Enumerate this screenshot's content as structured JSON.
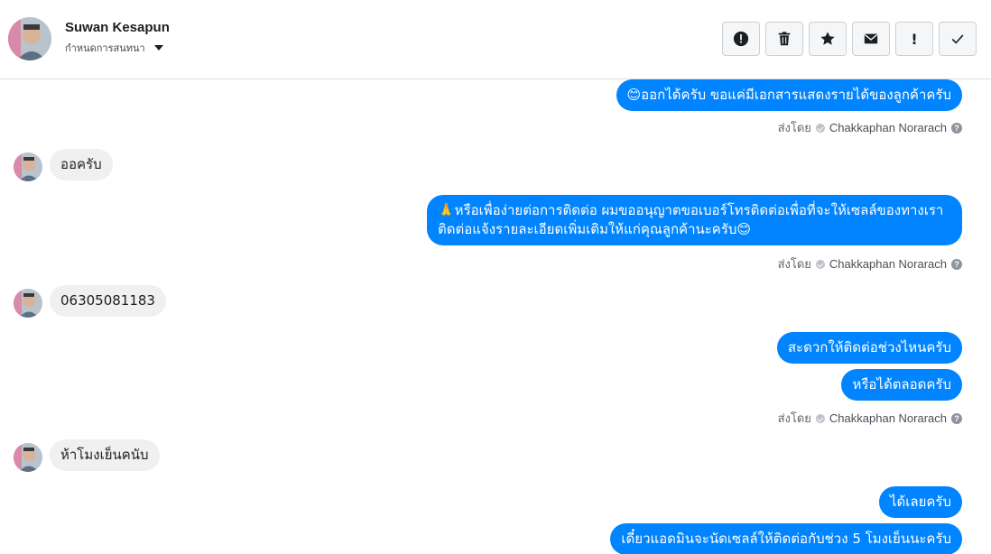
{
  "header": {
    "contact_name": "Suwan Kesapun",
    "assign_label": "กำหนดการสนทนา"
  },
  "toolbar": {
    "buttons": [
      {
        "name": "report-spam",
        "icon": "alert-circle-icon"
      },
      {
        "name": "delete",
        "icon": "trash-icon"
      },
      {
        "name": "star",
        "icon": "star-icon"
      },
      {
        "name": "mark-unread",
        "icon": "envelope-icon"
      },
      {
        "name": "follow-up",
        "icon": "exclamation-icon",
        "glyph": "!"
      },
      {
        "name": "mark-done",
        "icon": "checkmark-icon"
      }
    ]
  },
  "sent_by_label": "ส่งโดย",
  "agent_name": "Chakkaphan Norarach",
  "messages": {
    "m1": "😊ออกได้ครับ ขอแค่มีเอกสารแสดงรายได้ของลูกค้าครับ",
    "m2": "ออครับ",
    "m3": "🙏หรือเพื่อง่ายต่อการติดต่อ ผมขออนุญาตขอเบอร์โทรติดต่อเพื่อที่จะให้เซลล์ของทางเราติดต่อแจ้งรายละเอียดเพิ่มเติมให้แก่คุณลูกค้านะครับ😊",
    "m4": "06305081183",
    "m5": "สะดวกให้ติดต่อช่วงไหนครับ",
    "m6": "หรือได้ตลอดครับ",
    "m7": "ห้าโมงเย็นคนับ",
    "m8": "ได้เลยครับ",
    "m9": "เดี๋ยวแอดมินจะนัดเซลล์ให้ติดต่อกับช่วง 5 โมงเย็นนะครับ"
  }
}
